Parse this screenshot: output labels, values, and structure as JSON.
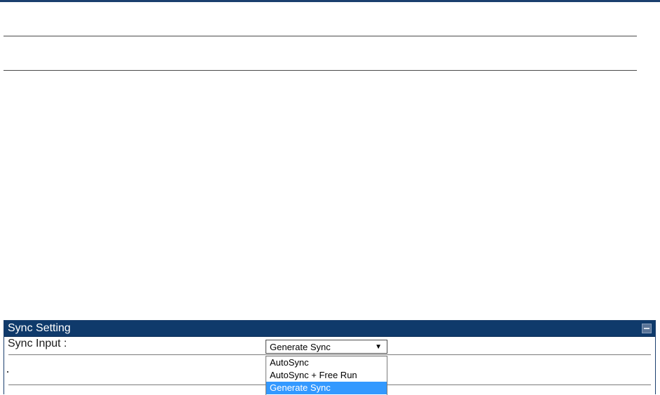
{
  "panel": {
    "title": "Sync Setting",
    "collapse_icon": "minus-square-icon"
  },
  "sync_input": {
    "label": "Sync Input :",
    "selected": "Generate Sync",
    "options": [
      "AutoSync",
      "AutoSync + Free Run",
      "Generate Sync"
    ],
    "highlighted_index": 2
  },
  "colors": {
    "header_bg": "#0f3a6b",
    "highlight": "#3399ff"
  }
}
